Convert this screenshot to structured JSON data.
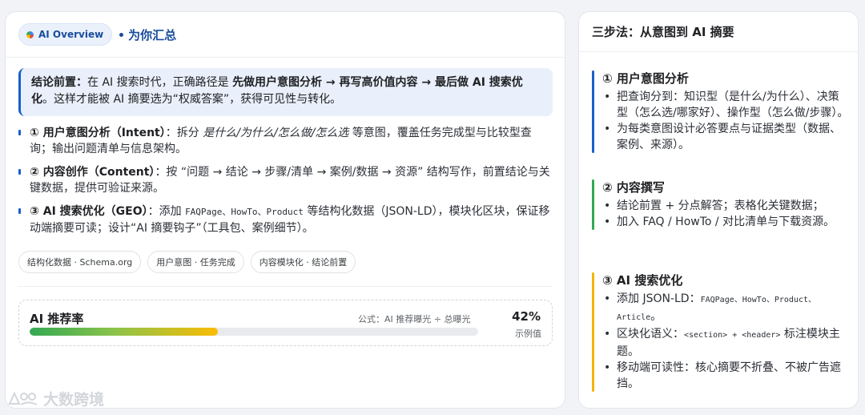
{
  "left": {
    "badge": "AI Overview",
    "title": "为你汇总",
    "conclusion": {
      "label": "结论前置：",
      "text1": "在 AI 搜索时代，正确路径是 ",
      "bold": "先做用户意图分析 → 再写高价值内容 → 最后做 AI 搜索优化",
      "text2": "。这样才能被 AI 摘要选为“权威答案”，获得可见性与转化。"
    },
    "steps": [
      {
        "title": "① 用户意图分析（Intent）",
        "pre": "：拆分 ",
        "italic": "是什么/为什么/怎么做/怎么选",
        "post": " 等意图，覆盖任务完成型与比较型查询；输出问题清单与信息架构。"
      },
      {
        "title": "② 内容创作（Content）",
        "text": "：按 “问题 → 结论 → 步骤/清单 → 案例/数据 → 资源” 结构写作，前置结论与关键数据，提供可验证来源。"
      },
      {
        "title": "③ AI 搜索优化（GEO）",
        "pre": "：添加 ",
        "code": "FAQPage、HowTo、Product",
        "post": " 等结构化数据（JSON-LD），模块化区块，保证移动端摘要可读；设计“AI 摘要钩子”（工具包、案例细节）。"
      }
    ],
    "tags": [
      "结构化数据 · Schema.org",
      "用户意图 · 任务完成",
      "内容模块化 · 结论前置"
    ],
    "metric": {
      "label": "AI 推荐率",
      "formula": "公式：AI 推荐曝光 ÷ 总曝光",
      "value": "42%",
      "fraction": 0.42,
      "note": "示例值"
    }
  },
  "right": {
    "title": "三步法：从意图到 AI 摘要",
    "sections": [
      {
        "title": "① 用户意图分析",
        "color": "#1a5fc8",
        "items": [
          "把查询分到：知识型（是什么/为什么）、决策型（怎么选/哪家好）、操作型（怎么做/步骤）。",
          "为每类意图设计必答要点与证据类型（数据、案例、来源）。"
        ]
      },
      {
        "title": "② 内容撰写",
        "color": "#34a853",
        "items": [
          "结论前置 + 分点解答；表格化关键数据；",
          "加入 FAQ / HowTo / 对比清单与下载资源。"
        ]
      },
      {
        "title": "③ AI 搜索优化",
        "color": "#f4b400",
        "items": [
          {
            "pre": "添加 JSON-LD：",
            "code": "FAQPage、HowTo、Product、Article",
            "post": "。"
          },
          {
            "pre": "区块化语义：",
            "code": "<section> + <header>",
            "post": " 标注模块主题。"
          },
          {
            "pre": "移动端可读性：核心摘要不折叠、不被广告遮挡。",
            "code": "",
            "post": ""
          }
        ]
      }
    ]
  },
  "watermark": "大数跨境",
  "colors": {
    "accent": "#1a5fc8",
    "green": "#34a853",
    "yellow": "#f4b400",
    "badge_bg": "#eaf1fb"
  }
}
